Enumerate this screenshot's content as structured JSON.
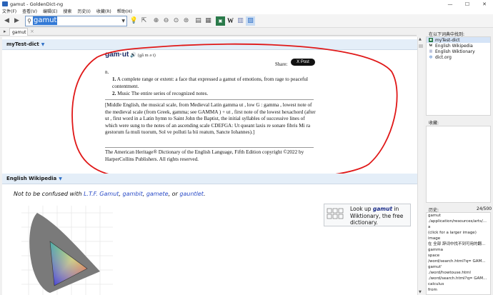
{
  "window": {
    "title": "gamut - GoldenDict-ng"
  },
  "menu": [
    "文件(F)",
    "查看(V)",
    "编辑(E)",
    "搜索",
    "历史(I)",
    "收藏(R)",
    "帮助(H)"
  ],
  "search": {
    "value": "gamut"
  },
  "tab": {
    "label": "gamut"
  },
  "dict1": {
    "name": "myTest-dict",
    "headword": "gam·ut",
    "pronunciation": "(gă m ə t)",
    "share": "Share:",
    "post": "X Post",
    "pos": "n.",
    "senses": [
      {
        "num": "1.",
        "text": "A complete range or extent: a face that expressed a gamut of emotions, from rage to peaceful contentment."
      },
      {
        "num": "2.",
        "text": "Music The entire series of recognized notes."
      }
    ],
    "etymology": "[Middle English, the musical scale, from Medieval Latin gamma ut , low G : gamma , lowest note of the medieval scale (from Greek, gamma; see GAMMA ) + ut , first note of the lowest hexachord (after ut , first word in a Latin hymn to Saint John the Baptist, the initial syllables of successive lines of which were sung to the notes of an ascending scale CDEFGA: Ut queant laxis re sonare fibris Mi ra gestorum fa muli tuorum, Sol ve polluti la bii reatum, Sancte Iohannes).]",
    "copyright": "The American Heritage® Dictionary of the English Language, Fifth Edition copyright ©2022 by HarperCollins Publishers. All rights reserved."
  },
  "dict2": {
    "name": "English Wikipedia",
    "note_prefix": "Not to be confused with ",
    "links": [
      "L.T.F. Gamut",
      "gambit",
      "gamete",
      "gauntlet"
    ],
    "sep1": ", ",
    "sep2": ", or ",
    "end": ".",
    "wikt_prefix": "Look up ",
    "wikt_word": "gamut",
    "wikt_suffix": " in Wiktionary, the free dictionary."
  },
  "found_label": "在以下词典中找到:",
  "found": [
    {
      "name": "myTest-dict",
      "icon": "book-icon"
    },
    {
      "name": "English Wikipedia",
      "icon": "wikipedia-icon"
    },
    {
      "name": "English Wiktionary",
      "icon": "wiktionary-icon"
    },
    {
      "name": "dict.org",
      "icon": "globe-icon"
    }
  ],
  "favorites_label": "收藏:",
  "history_label": "历史:",
  "history_count": "24/500",
  "history": [
    "gamut",
    "./application/resources/arts/...",
    "a",
    "(click for a larger image)",
    "image",
    "在 全部 辞词中找不到可用的翻...",
    "gamma",
    "space",
    "/word/search.html?q= GAM...",
    "gamut'",
    "./word/howtouse.html",
    "./word/search.html?q= GAM...",
    "calculus",
    "from"
  ],
  "colors": {
    "accent": "#2d6ec6",
    "annotation": "#e01818",
    "dictbar": "#e4eef8"
  }
}
